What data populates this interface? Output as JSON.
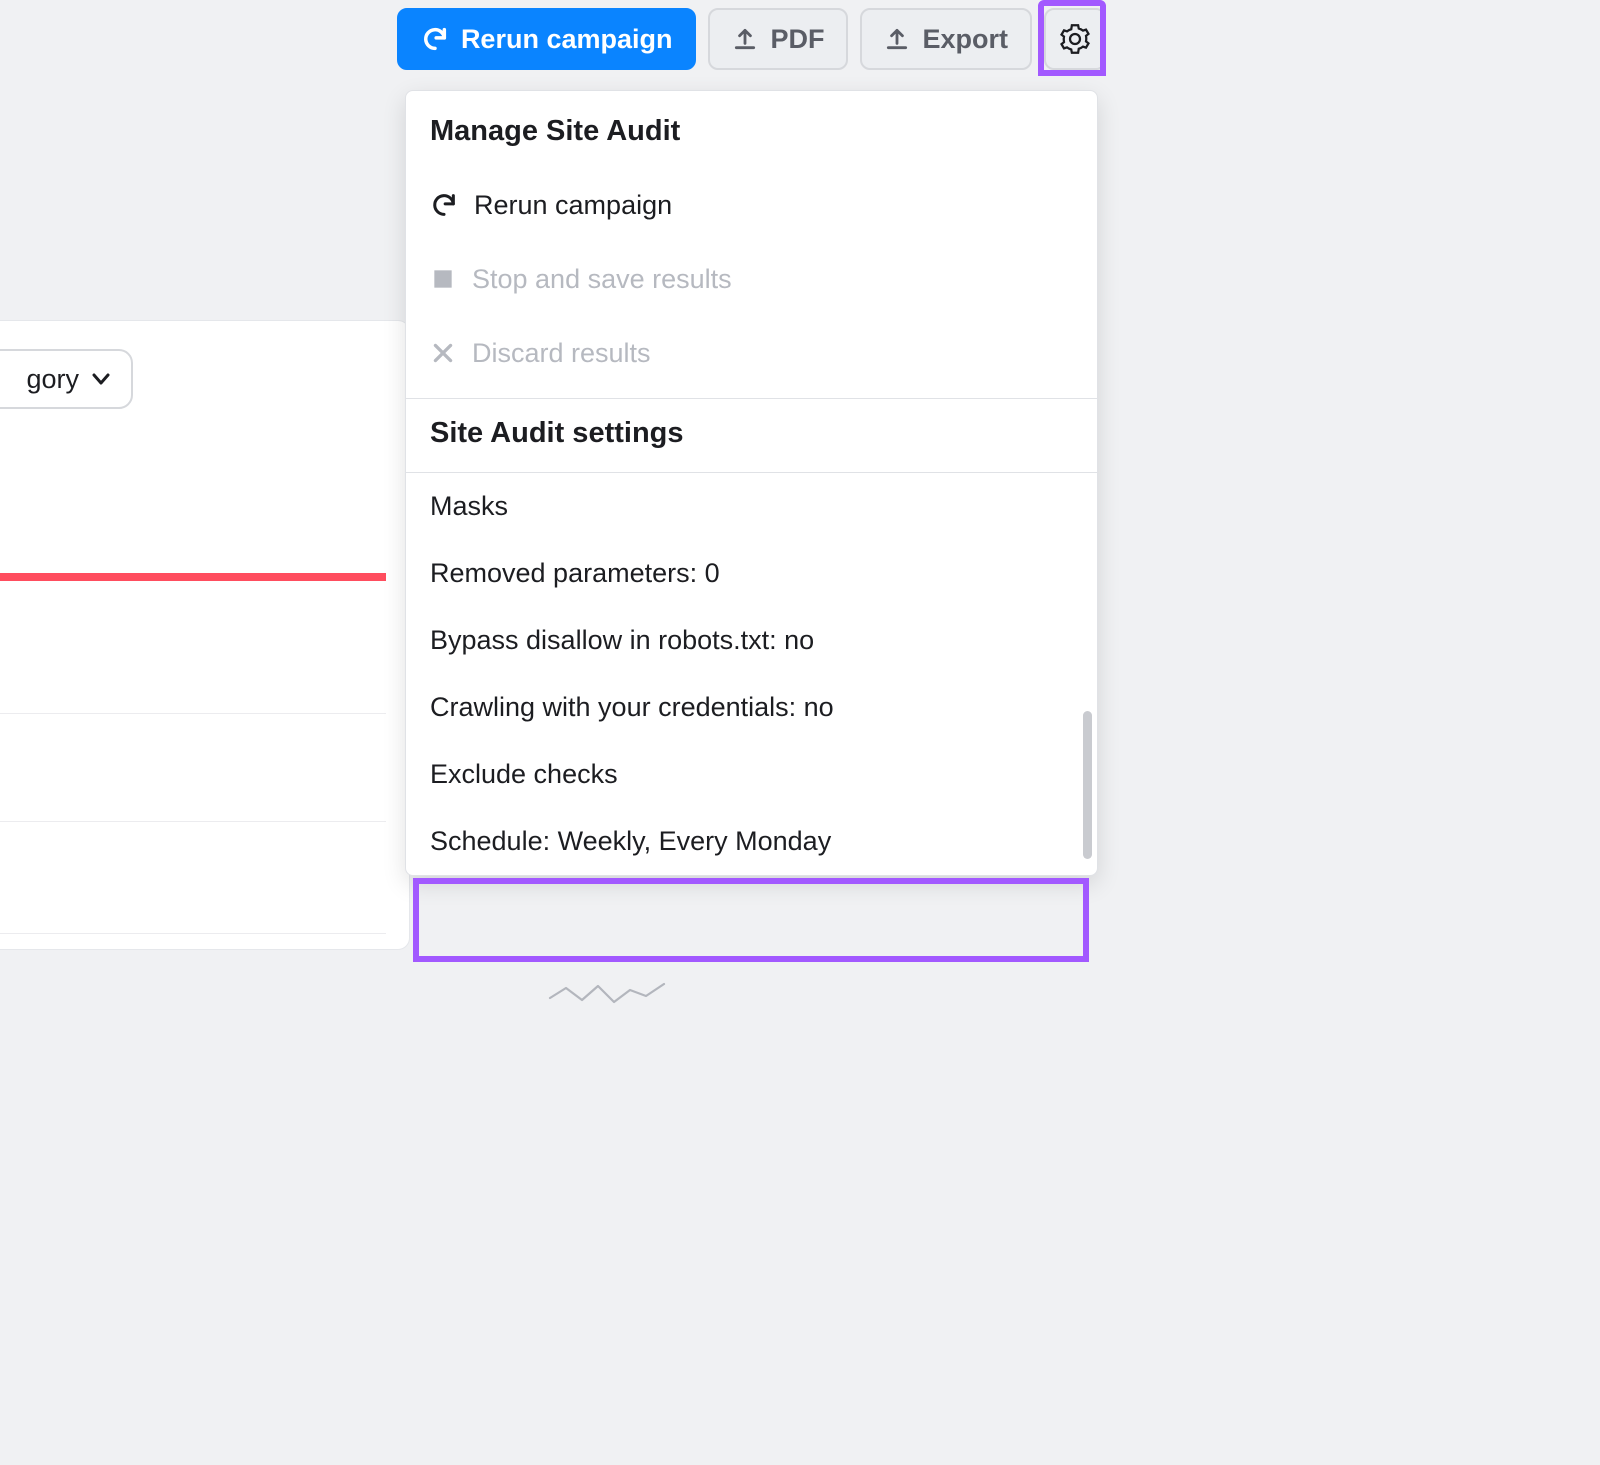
{
  "toolbar": {
    "rerun_label": "Rerun campaign",
    "pdf_label": "PDF",
    "export_label": "Export"
  },
  "category_filter": {
    "label_partial": "gory"
  },
  "dropdown": {
    "manage_title": "Manage Site Audit",
    "rerun_label": "Rerun campaign",
    "stop_label": "Stop and save results",
    "discard_label": "Discard results",
    "settings_title": "Site Audit settings",
    "items": [
      {
        "label": "Masks"
      },
      {
        "label": "Removed parameters: 0"
      },
      {
        "label": "Bypass disallow in robots.txt: no"
      },
      {
        "label": "Crawling with your credentials: no"
      },
      {
        "label": "Exclude checks"
      },
      {
        "label": "Schedule: Weekly, Every Monday"
      }
    ]
  }
}
